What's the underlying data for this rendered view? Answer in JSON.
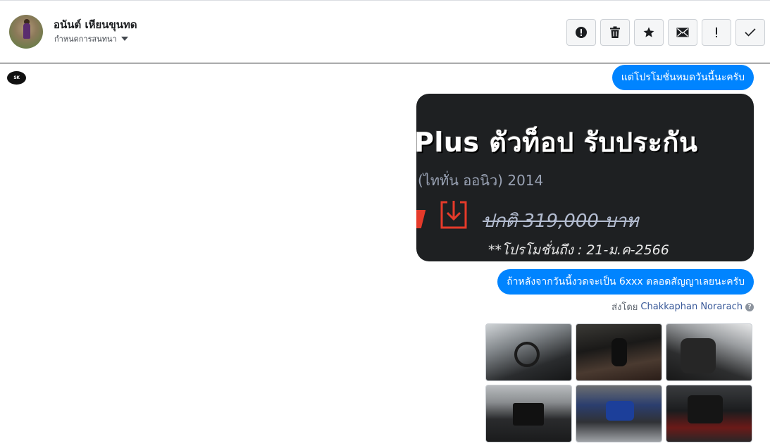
{
  "header": {
    "user_name": "อนันต์ เหียนขุนทด",
    "conversation_label": "กำหนดการสนทนา",
    "toolbar": [
      {
        "name": "spam-button",
        "icon": "alert-circle-icon"
      },
      {
        "name": "delete-button",
        "icon": "trash-icon"
      },
      {
        "name": "star-button",
        "icon": "star-icon"
      },
      {
        "name": "mark-unread-button",
        "icon": "envelope-icon"
      },
      {
        "name": "important-button",
        "icon": "exclamation-icon"
      },
      {
        "name": "mark-done-button",
        "icon": "check-icon"
      }
    ]
  },
  "thread": {
    "page_logo_text": "SK",
    "messages": [
      {
        "type": "text",
        "text": "แต่โปรโมชั่นหมดวันนี้นะครับ"
      },
      {
        "type": "image",
        "promo": {
          "line1": "Plus ตัวท็อป รับประกัน",
          "line2": "(ไททั่น ออนิว) 2014",
          "line3": "ปกติ 319,000 บาท",
          "line4": "**โปรโมชั่นถึง : 21-ม.ค-2566"
        }
      },
      {
        "type": "text",
        "text": "ถ้าหลังจากวันนี้งวดจะเป็น 6xxx ตลอดสัญญาเลยนะครับ"
      }
    ],
    "sent_by": {
      "prefix": "ส่งโดย",
      "sender": "Chakkaphan Norarach"
    },
    "gallery": [
      "car-dashboard-photo",
      "car-gear-shift-photo",
      "car-seats-photo",
      "car-console-photo",
      "car-engine-photo",
      "car-rear-seat-photo"
    ]
  },
  "colors": {
    "bubble": "#0084ff",
    "link": "#385898",
    "border": "#ccd0d5"
  }
}
